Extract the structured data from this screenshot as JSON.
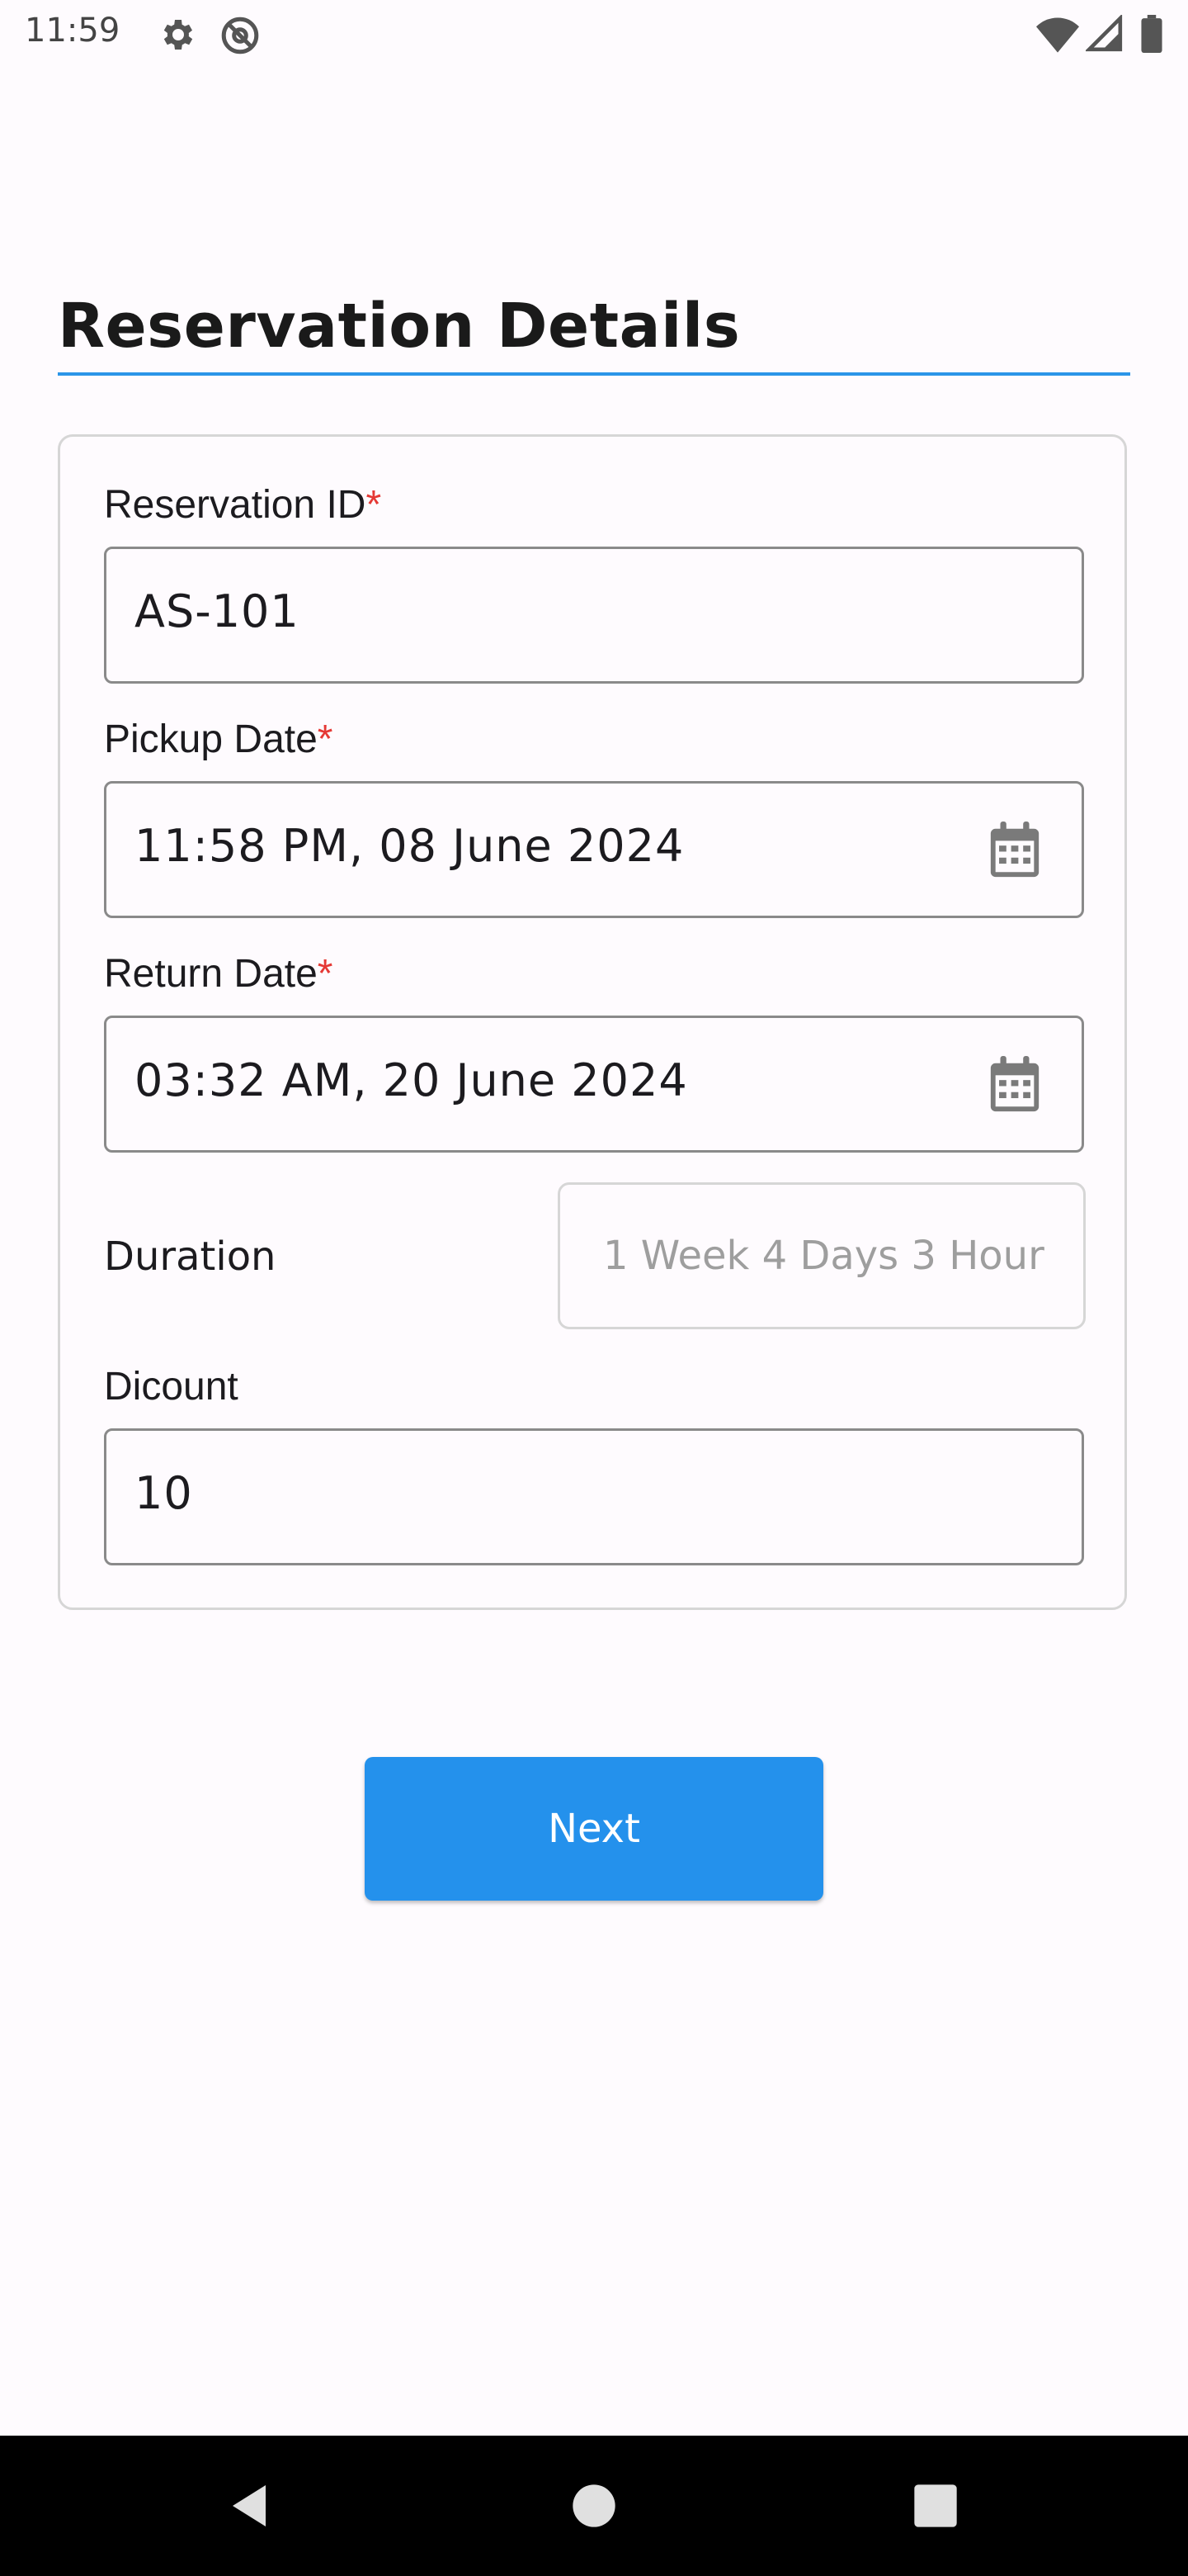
{
  "status_bar": {
    "time": "11:59",
    "icons": [
      "gear-icon",
      "at-sign-icon",
      "wifi-icon",
      "signal-icon",
      "battery-icon"
    ]
  },
  "page": {
    "title": "Reservation Details"
  },
  "form": {
    "reservation_id": {
      "label": "Reservation ID",
      "required_mark": "*",
      "value": "AS-101"
    },
    "pickup_date": {
      "label": "Pickup Date",
      "required_mark": "*",
      "value": "11:58 PM, 08 June 2024",
      "icon": "calendar-icon"
    },
    "return_date": {
      "label": "Return Date",
      "required_mark": "*",
      "value": "03:32 AM, 20 June 2024",
      "icon": "calendar-icon"
    },
    "duration": {
      "label": "Duration",
      "value": "1 Week 4 Days 3 Hour"
    },
    "discount": {
      "label": "Dicount",
      "value": "10"
    }
  },
  "actions": {
    "next_label": "Next"
  },
  "colors": {
    "accent": "#2491ec",
    "required": "#e53935",
    "background": "#fefbfe",
    "nav_bar": "#000000"
  },
  "nav_bar": {
    "icons": [
      "back-icon",
      "home-icon",
      "recents-icon"
    ]
  }
}
